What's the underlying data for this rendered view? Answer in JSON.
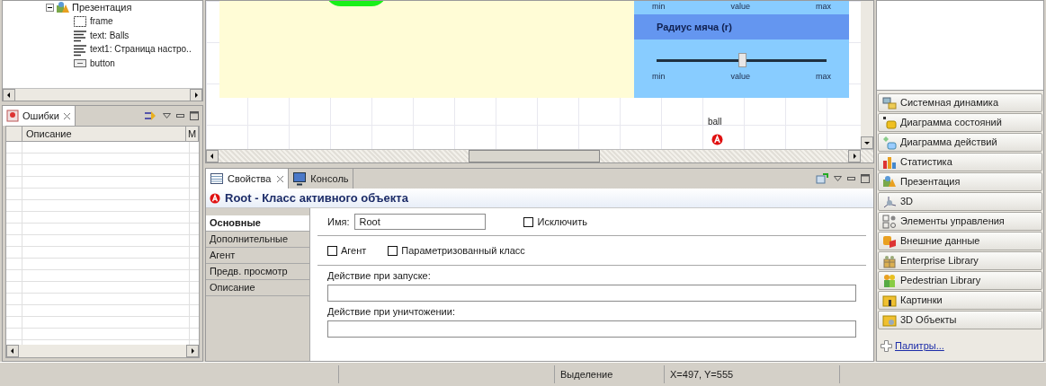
{
  "outline": {
    "items": [
      {
        "label": "Презентация",
        "kind": "presentation",
        "expanded": true,
        "children": [
          {
            "label": "frame",
            "kind": "frame"
          },
          {
            "label": "text: Balls",
            "kind": "text"
          },
          {
            "label": "text1: Страница настро..",
            "kind": "text"
          },
          {
            "label": "button",
            "kind": "button"
          }
        ]
      }
    ]
  },
  "problems": {
    "tab": "Ошибки",
    "columns": [
      "Описание",
      "М"
    ]
  },
  "canvas": {
    "sliders": [
      {
        "labels": [
          "min",
          "value",
          "max"
        ]
      },
      {
        "title": "Радиус мяча (r)",
        "level": 0.5,
        "labels": [
          "min",
          "value",
          "max"
        ]
      }
    ],
    "agent": {
      "label": "ball"
    }
  },
  "properties": {
    "tabs": [
      {
        "label": "Свойства",
        "selected": true,
        "closable": true,
        "kind": "table"
      },
      {
        "label": "Консоль",
        "selected": false,
        "closable": false,
        "kind": "console"
      }
    ],
    "title": "Root - Класс активного объекта",
    "sections": [
      {
        "label": "Основные",
        "selected": true
      },
      {
        "label": "Дополнительные",
        "selected": false
      },
      {
        "label": "Агент",
        "selected": false
      },
      {
        "label": "Предв. просмотр",
        "selected": false
      },
      {
        "label": "Описание",
        "selected": false
      }
    ],
    "name": {
      "label": "Имя:",
      "value": "Root"
    },
    "exclude": {
      "label": "Исключить",
      "checked": false
    },
    "options": [
      {
        "label": "Агент",
        "checked": false
      },
      {
        "label": "Параметризованный класс",
        "checked": false
      }
    ],
    "actions": [
      {
        "label": "Действие при запуске:"
      },
      {
        "label": "Действие при уничтожении:"
      }
    ]
  },
  "palette": {
    "items": [
      {
        "label": "Системная динамика",
        "kind": "sd"
      },
      {
        "label": "Диаграмма состояний",
        "kind": "state"
      },
      {
        "label": "Диаграмма действий",
        "kind": "action"
      },
      {
        "label": "Статистика",
        "kind": "stats"
      },
      {
        "label": "Презентация",
        "kind": "presentation"
      },
      {
        "label": "3D",
        "kind": "axes"
      },
      {
        "label": "Элементы управления",
        "kind": "controls"
      },
      {
        "label": "Внешние данные",
        "kind": "data"
      },
      {
        "label": "Enterprise Library",
        "kind": "enterprise"
      },
      {
        "label": "Pedestrian Library",
        "kind": "pedestrian"
      },
      {
        "label": "Картинки",
        "kind": "pictures"
      },
      {
        "label": "3D Объекты",
        "kind": "objects"
      }
    ],
    "link": "Палитры..."
  },
  "status_bar": {
    "mode": "Выделение",
    "coords": "X=497, Y=555"
  }
}
